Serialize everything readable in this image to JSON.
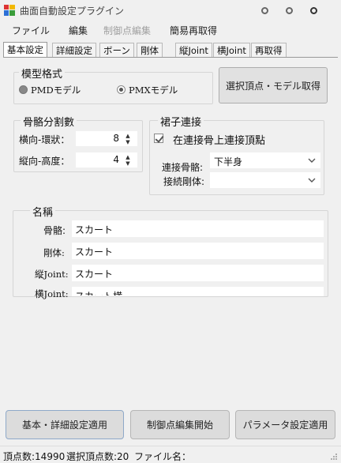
{
  "window": {
    "title": "曲面自動設定プラグイン",
    "icon": "app-icon"
  },
  "menu": [
    "ファイル",
    "編集",
    "制御点編集",
    "簡易再取得"
  ],
  "menu_disabled": [
    false,
    false,
    true,
    false
  ],
  "tabs": [
    "基本設定",
    "詳細設定",
    "ボーン",
    "剛体",
    "縦Joint",
    "横Joint",
    "再取得"
  ],
  "active_tab": 0,
  "model_format": {
    "title": "模型格式",
    "pmd_label": "PMDモデル",
    "pmx_label": "PMXモデル",
    "selected": "pmd"
  },
  "get_vertex_button": "選択頂点・モデル取得",
  "bone_split": {
    "title": "骨骼分割數",
    "horizontal_label": "横向-環狀：",
    "horizontal_value": "8",
    "vertical_label": "縦向-高度：",
    "vertical_value": "4"
  },
  "skirt_connect": {
    "title": "裙子連接",
    "checkbox_label": "在連接骨上連接頂點",
    "checked": true,
    "bone_label": "連接骨骼:",
    "bone_value": "下半身",
    "rigid_label": "接続剛体:",
    "rigid_value": ""
  },
  "names": {
    "title": "名稱",
    "bone_label": "骨骼:",
    "bone_value": "スカート",
    "rigid_label": "剛体:",
    "rigid_value": "スカート",
    "vjoint_label": "縦Joint:",
    "vjoint_value": "スカート",
    "hjoint_label": "横Joint:",
    "hjoint_value": "スカート横"
  },
  "bottom_buttons": {
    "apply_basic": "基本・詳細設定適用",
    "start_edit": "制御点編集開始",
    "apply_params": "パラメータ設定適用"
  },
  "status": {
    "vertex_count": "頂点数:14990",
    "selected_count": "選択頂点数:20",
    "file_name": "ファイル名："
  }
}
